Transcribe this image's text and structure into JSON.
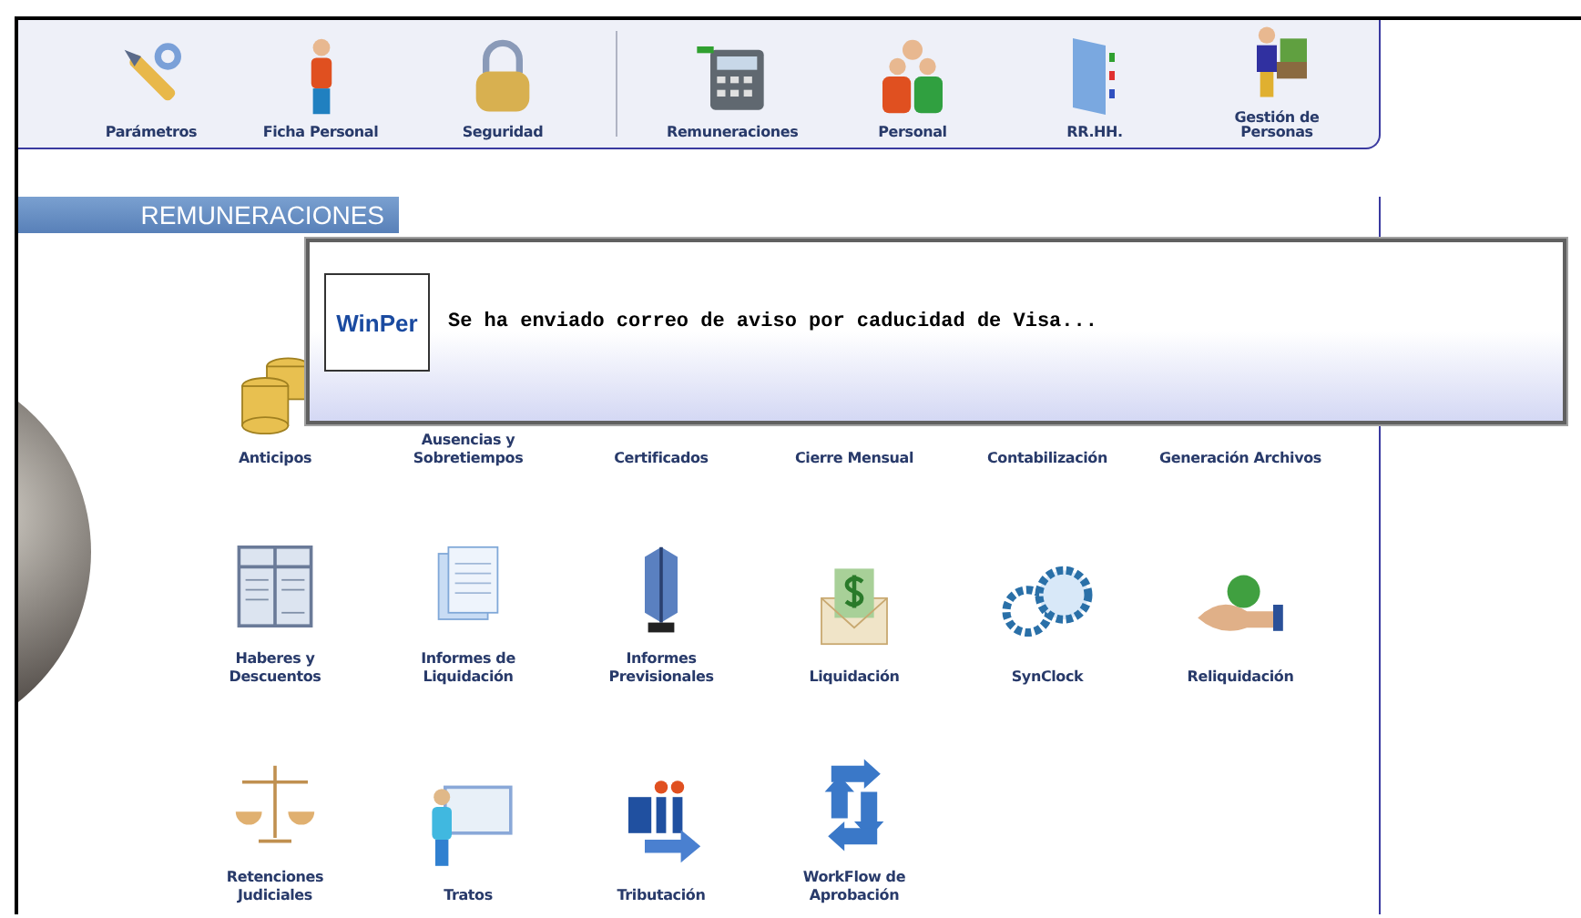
{
  "toolbar": {
    "groups": [
      [
        {
          "label": "Parámetros"
        },
        {
          "label": "Ficha Personal"
        },
        {
          "label": "Seguridad"
        }
      ],
      [
        {
          "label": "Remuneraciones"
        },
        {
          "label": "Personal"
        },
        {
          "label": "RR.HH."
        },
        {
          "label": "Gestión de Personas"
        }
      ]
    ]
  },
  "section": {
    "title": "REMUNERACIONES"
  },
  "modules": [
    [
      {
        "label": "Anticipos"
      },
      {
        "label": "Ausencias y Sobretiempos"
      },
      {
        "label": "Certificados"
      },
      {
        "label": "Cierre Mensual"
      },
      {
        "label": "Contabilización"
      },
      {
        "label": "Generación Archivos"
      }
    ],
    [
      {
        "label": "Haberes y Descuentos"
      },
      {
        "label": "Informes de Liquidación"
      },
      {
        "label": "Informes Previsionales"
      },
      {
        "label": "Liquidación"
      },
      {
        "label": "SynClock"
      },
      {
        "label": "Reliquidación"
      }
    ],
    [
      {
        "label": "Retenciones Judiciales"
      },
      {
        "label": "Tratos"
      },
      {
        "label": "Tributación"
      },
      {
        "label": "WorkFlow de Aprobación"
      }
    ]
  ],
  "dialog": {
    "logo": "WinPer",
    "message": "Se ha enviado correo de aviso por caducidad de Visa..."
  }
}
